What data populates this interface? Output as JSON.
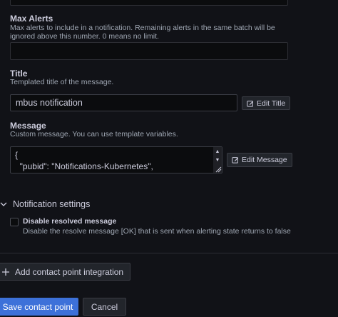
{
  "max_alerts": {
    "label": "Max Alerts",
    "description_line1": "Max alerts to include in a notification. Remaining alerts in the same batch will be",
    "description_line2": "ignored above this number. 0 means no limit.",
    "value": ""
  },
  "title_field": {
    "label": "Title",
    "description": "Templated title of the message.",
    "value": "mbus notification",
    "edit_button_label": "Edit Title",
    "edit_icon": "pencil-square-icon"
  },
  "message_field": {
    "label": "Message",
    "description": "Custom message. You can use template variables.",
    "line1": "{",
    "line2": "  \"pubid\": \"Notifications-Kubernetes\",",
    "edit_button_label": "Edit Message",
    "edit_icon": "pencil-square-icon"
  },
  "notification_settings": {
    "header": "Notification settings",
    "chevron_icon": "chevron-down-icon",
    "disable_resolved": {
      "label": "Disable resolved message",
      "description": "Disable the resolve message [OK] that is sent when alerting state returns to false",
      "checked": false
    }
  },
  "actions": {
    "add_integration_label": "Add contact point integration",
    "add_icon": "plus-icon",
    "save_label": "Save contact point",
    "cancel_label": "Cancel"
  },
  "colors": {
    "background": "#111217",
    "input_background": "#0b0c0e",
    "primary": "#3d71d9",
    "border": "#3a3c44"
  }
}
